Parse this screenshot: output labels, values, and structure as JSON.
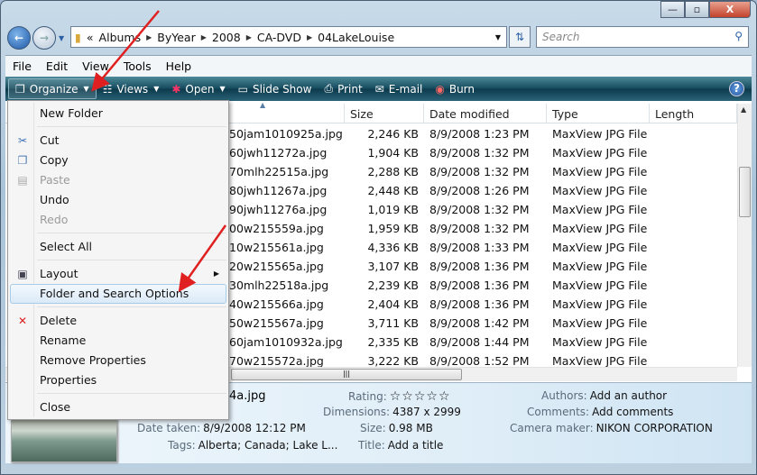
{
  "window": {
    "controls": [
      "minimize",
      "maximize",
      "close"
    ]
  },
  "address": {
    "overflow": "«",
    "crumbs": [
      "Albums",
      "ByYear",
      "2008",
      "CA-DVD",
      "04LakeLouise"
    ]
  },
  "search": {
    "placeholder": "Search"
  },
  "menubar": [
    "File",
    "Edit",
    "View",
    "Tools",
    "Help"
  ],
  "toolbar": {
    "organize": "Organize",
    "views": "Views",
    "open": "Open",
    "slideshow": "Slide Show",
    "print": "Print",
    "email": "E-mail",
    "burn": "Burn"
  },
  "columns": [
    "",
    "Size",
    "Date modified",
    "Type",
    "Length"
  ],
  "files": [
    {
      "name": "50jam1010925a.jpg",
      "size": "2,246 KB",
      "date": "8/9/2008 1:23 PM",
      "type": "MaxView JPG File"
    },
    {
      "name": "60jwh11272a.jpg",
      "size": "1,904 KB",
      "date": "8/9/2008 1:32 PM",
      "type": "MaxView JPG File"
    },
    {
      "name": "70mlh22515a.jpg",
      "size": "2,288 KB",
      "date": "8/9/2008 1:32 PM",
      "type": "MaxView JPG File"
    },
    {
      "name": "80jwh11267a.jpg",
      "size": "2,448 KB",
      "date": "8/9/2008 1:26 PM",
      "type": "MaxView JPG File"
    },
    {
      "name": "90jwh11276a.jpg",
      "size": "1,019 KB",
      "date": "8/9/2008 1:32 PM",
      "type": "MaxView JPG File"
    },
    {
      "name": "00w215559a.jpg",
      "size": "1,959 KB",
      "date": "8/9/2008 1:32 PM",
      "type": "MaxView JPG File"
    },
    {
      "name": "10w215561a.jpg",
      "size": "4,336 KB",
      "date": "8/9/2008 1:33 PM",
      "type": "MaxView JPG File"
    },
    {
      "name": "20w215565a.jpg",
      "size": "3,107 KB",
      "date": "8/9/2008 1:36 PM",
      "type": "MaxView JPG File"
    },
    {
      "name": "30mlh22518a.jpg",
      "size": "2,239 KB",
      "date": "8/9/2008 1:36 PM",
      "type": "MaxView JPG File"
    },
    {
      "name": "40w215566a.jpg",
      "size": "2,404 KB",
      "date": "8/9/2008 1:36 PM",
      "type": "MaxView JPG File"
    },
    {
      "name": "50w215567a.jpg",
      "size": "3,711 KB",
      "date": "8/9/2008 1:42 PM",
      "type": "MaxView JPG File"
    },
    {
      "name": "60jam1010932a.jpg",
      "size": "2,335 KB",
      "date": "8/9/2008 1:44 PM",
      "type": "MaxView JPG File"
    },
    {
      "name": "70w215572a.jpg",
      "size": "3,222 KB",
      "date": "8/9/2008 1:52 PM",
      "type": "MaxView JPG File"
    }
  ],
  "organize_menu": [
    {
      "label": "New Folder"
    },
    {
      "label": "Cut",
      "icon": "scissors-icon"
    },
    {
      "label": "Copy",
      "icon": "copy-icon"
    },
    {
      "label": "Paste",
      "icon": "paste-icon",
      "disabled": true
    },
    {
      "label": "Undo"
    },
    {
      "label": "Redo",
      "disabled": true
    },
    {
      "label": "Select All"
    },
    {
      "label": "Layout",
      "icon": "layout-icon",
      "submenu": true
    },
    {
      "label": "Folder and Search Options",
      "highlighted": true
    },
    {
      "label": "Delete",
      "icon": "delete-icon"
    },
    {
      "label": "Rename"
    },
    {
      "label": "Remove Properties"
    },
    {
      "label": "Properties"
    },
    {
      "label": "Close"
    }
  ],
  "details": {
    "name": "4a.jpg",
    "date_taken_label": "Date taken:",
    "date_taken": "8/9/2008 12:12 PM",
    "tags_label": "Tags:",
    "tags": "Alberta; Canada; Lake L...",
    "rating_label": "Rating:",
    "rating": 0,
    "rating_max": 5,
    "dimensions_label": "Dimensions:",
    "dimensions": "4387 x 2999",
    "size_label": "Size:",
    "size": "0.98 MB",
    "title_label": "Title:",
    "title": "Add a title",
    "authors_label": "Authors:",
    "authors": "Add an author",
    "comments_label": "Comments:",
    "comments": "Add comments",
    "camera_label": "Camera maker:",
    "camera": "NIKON CORPORATION"
  },
  "annotation_color": "#e02020"
}
